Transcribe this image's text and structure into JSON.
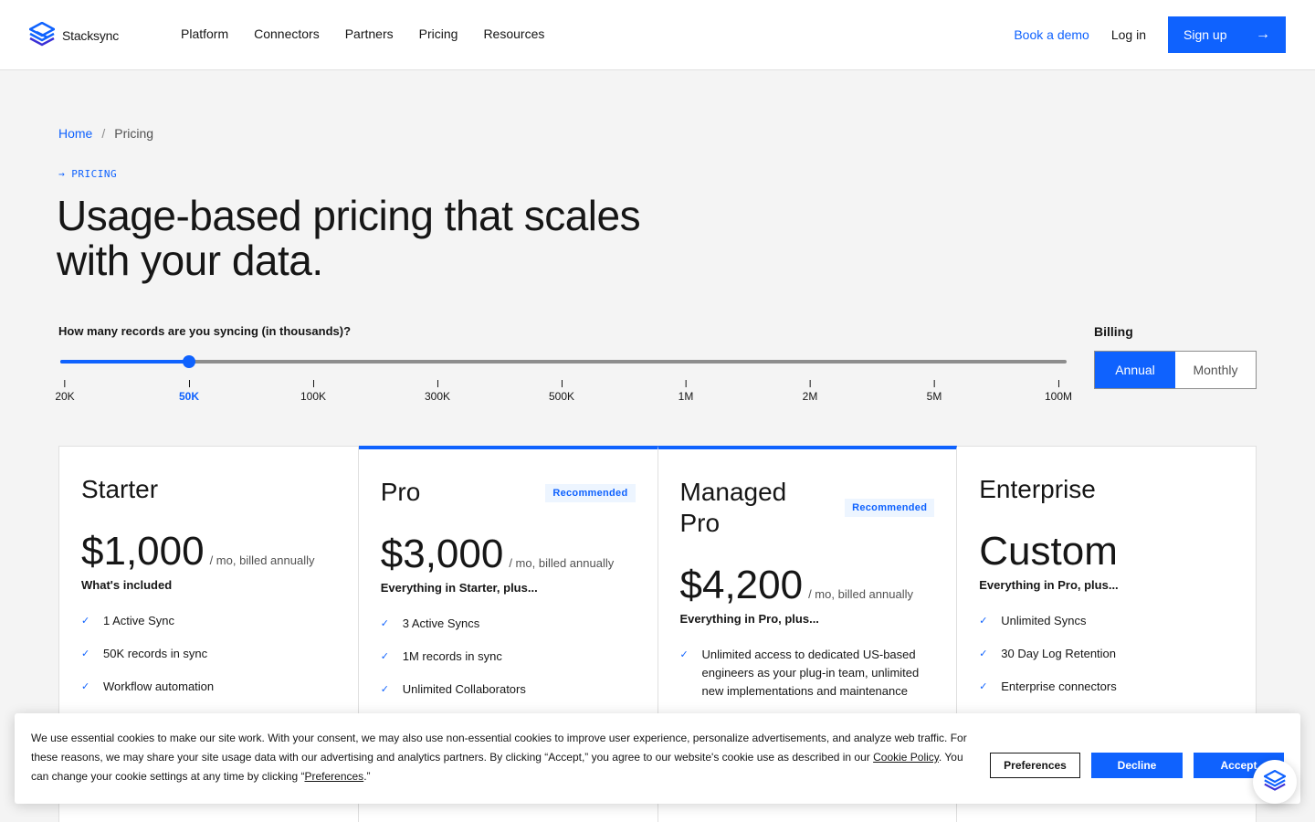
{
  "brand": {
    "name": "Stacksync",
    "color": "#0f62fe"
  },
  "nav": {
    "items": [
      "Platform",
      "Connectors",
      "Partners",
      "Pricing",
      "Resources"
    ]
  },
  "header_actions": {
    "demo": "Book a demo",
    "login": "Log in",
    "signup": "Sign up"
  },
  "breadcrumb": {
    "home": "Home",
    "separator": "/",
    "current": "Pricing"
  },
  "eyebrow": "→ PRICING",
  "headline": "Usage-based pricing that scales with your data.",
  "slider": {
    "question": "How many records are you syncing (in thousands)?",
    "ticks": [
      "20K",
      "50K",
      "100K",
      "300K",
      "500K",
      "1M",
      "2M",
      "5M",
      "100M"
    ],
    "selected_index": 1
  },
  "billing": {
    "label": "Billing",
    "options": [
      "Annual",
      "Monthly"
    ],
    "selected": "Annual"
  },
  "plans": [
    {
      "name": "Starter",
      "badge": "",
      "price": "$1,000",
      "price_sub": "/ mo, billed annually",
      "included": "What's included",
      "features": [
        "1 Active Sync",
        "50K records in sync",
        "Workflow automation"
      ]
    },
    {
      "name": "Pro",
      "badge": "Recommended",
      "price": "$3,000",
      "price_sub": "/ mo, billed annually",
      "included": "Everything in Starter, plus...",
      "features": [
        "3 Active Syncs",
        "1M records in sync",
        "Unlimited Collaborators"
      ]
    },
    {
      "name": "Managed Pro",
      "badge": "Recommended",
      "price": "$4,200",
      "price_sub": "/ mo, billed annually",
      "included": "Everything in Pro, plus...",
      "features": [
        "Unlimited access to dedicated US-based engineers as your plug-in team, unlimited new implementations and maintenance"
      ]
    },
    {
      "name": "Enterprise",
      "badge": "",
      "price": "Custom",
      "price_sub": "",
      "included": "Everything in Pro, plus...",
      "features": [
        "Unlimited Syncs",
        "30 Day Log Retention",
        "Enterprise connectors"
      ]
    }
  ],
  "cookie": {
    "text_1": "We use essential cookies to make our site work. With your consent, we may also use non-essential cookies to improve user experience, personalize advertisements, and analyze web traffic. For these reasons, we may share your site usage data with our advertising and analytics partners. By clicking “Accept,” you agree to our website's cookie use as described in our ",
    "policy_link": "Cookie Policy",
    "text_2": ". You can change your cookie settings at any time by clicking “",
    "pref_link": "Preferences",
    "text_3": ".”",
    "buttons": {
      "preferences": "Preferences",
      "decline": "Decline",
      "accept": "Accept"
    }
  }
}
